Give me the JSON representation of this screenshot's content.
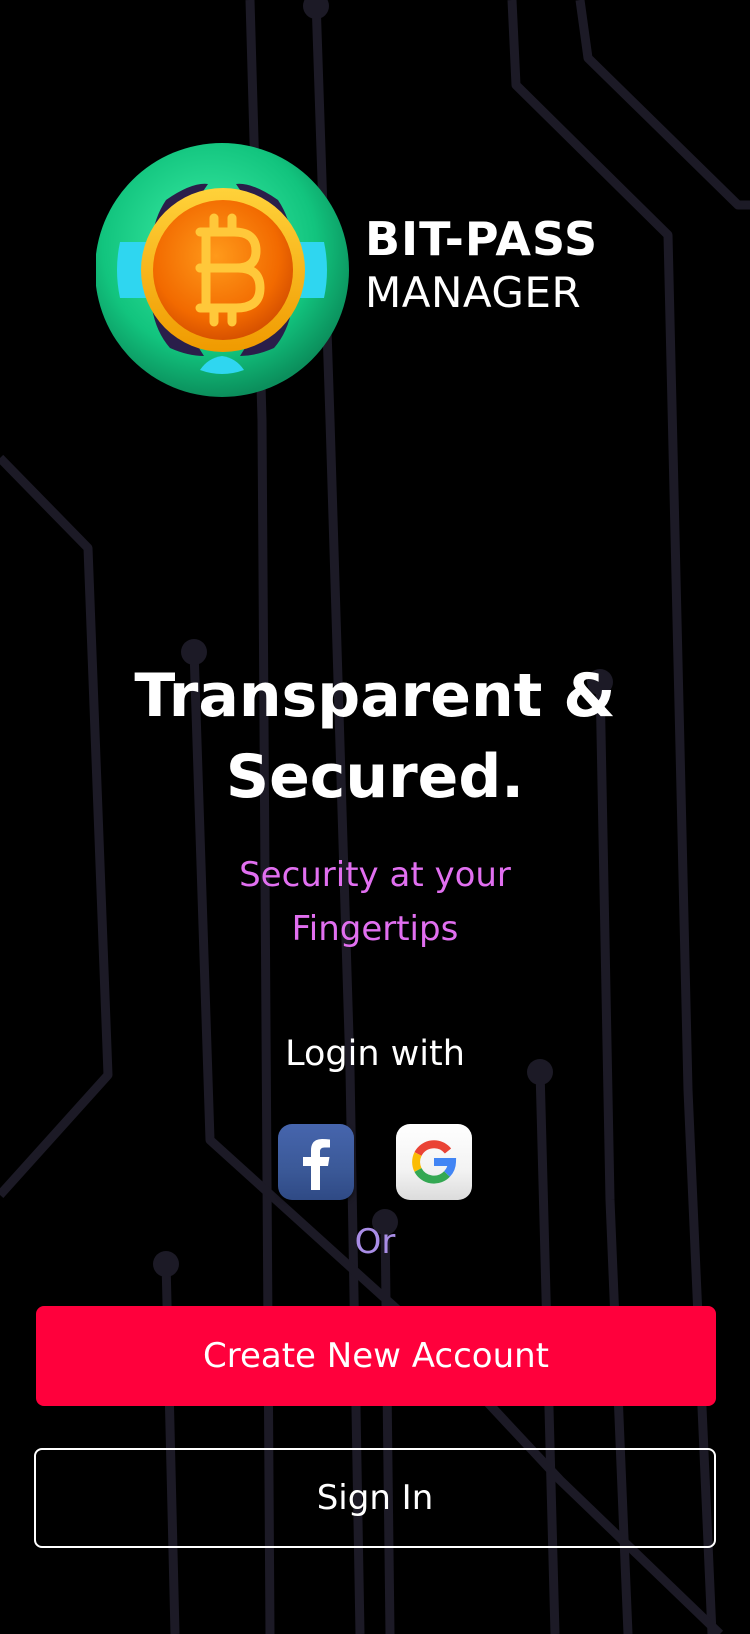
{
  "brand": {
    "line1": "BIT-PASS",
    "line2": "MANAGER",
    "logo_icon": "bitcoin-globe-icon"
  },
  "hero": {
    "title_line1": "Transparent &",
    "title_line2": "Secured.",
    "subtitle_line1": "Security at your",
    "subtitle_line2": "Fingertips"
  },
  "login": {
    "label": "Login with",
    "providers": [
      {
        "name": "facebook",
        "icon": "facebook-icon"
      },
      {
        "name": "google",
        "icon": "google-icon"
      }
    ],
    "or_label": "Or"
  },
  "actions": {
    "create_account_label": "Create New Account",
    "sign_in_label": "Sign In"
  },
  "colors": {
    "background": "#000000",
    "accent": "#ff003c",
    "subtitle": "#e16ff0",
    "or_text": "#a98de6",
    "circuit_lines": "#1c1a26"
  }
}
